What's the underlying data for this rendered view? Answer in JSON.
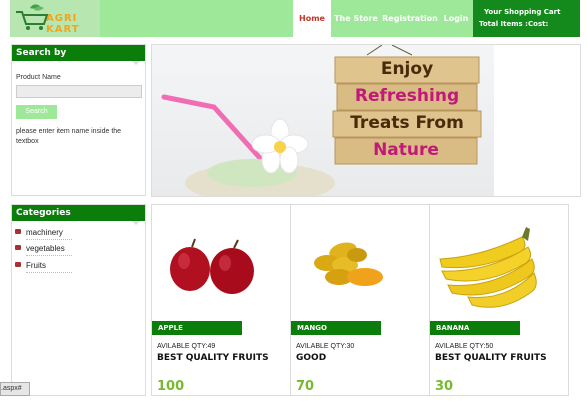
{
  "brand": {
    "logo_text": "AGRI KART"
  },
  "nav": {
    "items": [
      "Home",
      "The Store",
      "Registration",
      "Login"
    ]
  },
  "cart": {
    "title": "Your Shopping Cart",
    "total_label": "Total Items :",
    "cost_label": "Cost:"
  },
  "search": {
    "title": "Search by",
    "label": "Product Name",
    "value": "",
    "placeholder": "",
    "button": "Search",
    "hint": "please enter item name inside the textbox"
  },
  "banner": {
    "lines": [
      "Enjoy",
      "Refreshing",
      "Treats From",
      "Nature"
    ],
    "slide_count": 4,
    "active_slide": 1
  },
  "categories": {
    "title": "Categories",
    "items": [
      "machinery",
      "vegetables",
      "Fruits"
    ]
  },
  "products": [
    {
      "name": "APPLE",
      "qty": "AVILABLE QTY:49",
      "desc": "BEST QUALITY FRUITS",
      "price": "100"
    },
    {
      "name": "MANGO",
      "qty": "AVILABLE QTY:30",
      "desc": "GOOD",
      "price": "70"
    },
    {
      "name": "BANANA",
      "qty": "AVILABLE QTY:50",
      "desc": "BEST QUALITY FRUITS",
      "price": "30"
    }
  ],
  "status_bar": {
    "text": ".aspx#"
  },
  "colors": {
    "primary_green": "#0a7d0a",
    "light_green": "#9ee89a",
    "price_green": "#7ab82f",
    "active_nav": "#c0392b"
  }
}
